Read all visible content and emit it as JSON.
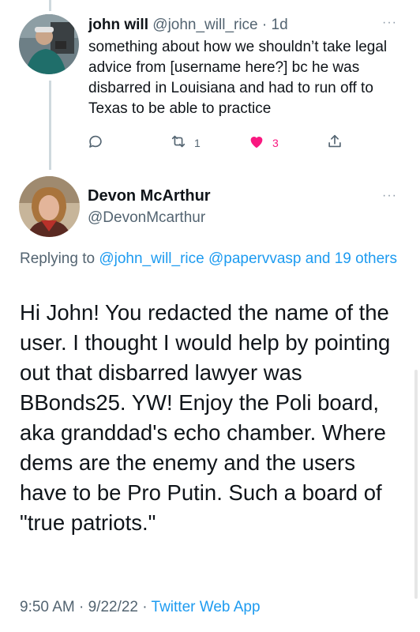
{
  "reply": {
    "name": "john will",
    "handle": "@john_will_rice",
    "time": "1d",
    "text": "something about how we shouldn’t take legal advice from [username here?] bc he was disbarred in Louisiana and had to run off to Texas to be able to practice",
    "retweets": "1",
    "likes": "3"
  },
  "main": {
    "name": "Devon McArthur",
    "handle": "@DevonMcarthur",
    "replying_prefix": "Replying to ",
    "replying_users": "@john_will_rice @papervvasp",
    "replying_suffix": " and 19 others",
    "text": "Hi John! You redacted the name of the user. I thought I would help by pointing out that disbarred lawyer was BBonds25. YW! Enjoy the Poli board, aka granddad's echo chamber. Where dems are the enemy and the users have to be Pro Putin. Such a board of \"true patriots.\"",
    "time": "9:50 AM · 9/22/22 · ",
    "source": "Twitter Web App"
  },
  "icons": [
    "reply-icon",
    "retweet-icon",
    "heart-icon",
    "share-icon",
    "more-icon"
  ],
  "colors": {
    "accent": "#1d9bf0",
    "like": "#f91880",
    "secondary": "#536471"
  }
}
